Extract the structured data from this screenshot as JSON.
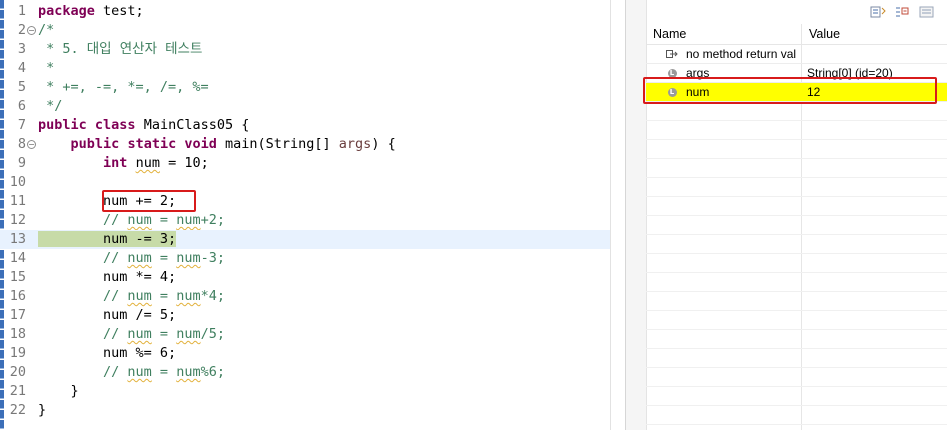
{
  "editor": {
    "lines": [
      {
        "n": "1",
        "fold": false,
        "current": false,
        "parts": [
          {
            "t": "package",
            "c": "kw"
          },
          {
            "t": " test;"
          }
        ]
      },
      {
        "n": "2",
        "fold": true,
        "current": false,
        "parts": [
          {
            "t": "/*",
            "c": "cmt"
          }
        ]
      },
      {
        "n": "3",
        "fold": false,
        "current": false,
        "parts": [
          {
            "t": " * 5. 대입 연산자 테스트",
            "c": "cmt"
          }
        ]
      },
      {
        "n": "4",
        "fold": false,
        "current": false,
        "parts": [
          {
            "t": " *",
            "c": "cmt"
          }
        ]
      },
      {
        "n": "5",
        "fold": false,
        "current": false,
        "parts": [
          {
            "t": " * +=, -=, *=, /=, %=",
            "c": "cmt"
          }
        ]
      },
      {
        "n": "6",
        "fold": false,
        "current": false,
        "parts": [
          {
            "t": " */",
            "c": "cmt"
          }
        ]
      },
      {
        "n": "7",
        "fold": false,
        "current": false,
        "parts": [
          {
            "t": "public",
            "c": "kw"
          },
          {
            "t": " "
          },
          {
            "t": "class",
            "c": "kw"
          },
          {
            "t": " MainClass05 {"
          }
        ]
      },
      {
        "n": "8",
        "fold": true,
        "current": false,
        "parts": [
          {
            "t": "    "
          },
          {
            "t": "public",
            "c": "kw"
          },
          {
            "t": " "
          },
          {
            "t": "static",
            "c": "kw"
          },
          {
            "t": " "
          },
          {
            "t": "void",
            "c": "kw"
          },
          {
            "t": " main(String[] "
          },
          {
            "t": "args",
            "c": "var"
          },
          {
            "t": ") {"
          }
        ]
      },
      {
        "n": "9",
        "fold": false,
        "current": false,
        "parts": [
          {
            "t": "        "
          },
          {
            "t": "int",
            "c": "kw"
          },
          {
            "t": " "
          },
          {
            "t": "num",
            "c": "sq"
          },
          {
            "t": " = 10;"
          }
        ]
      },
      {
        "n": "10",
        "fold": false,
        "current": false,
        "parts": []
      },
      {
        "n": "11",
        "fold": false,
        "current": false,
        "parts": [
          {
            "t": "        num += 2;"
          }
        ]
      },
      {
        "n": "12",
        "fold": false,
        "current": false,
        "parts": [
          {
            "t": "        // ",
            "c": "cmt"
          },
          {
            "t": "num",
            "c": "cmt sq"
          },
          {
            "t": " = ",
            "c": "cmt"
          },
          {
            "t": "num",
            "c": "cmt sq"
          },
          {
            "t": "+2;",
            "c": "cmt"
          }
        ]
      },
      {
        "n": "13",
        "fold": false,
        "current": true,
        "parts": [
          {
            "t": "        num -= 3;",
            "c": "sel"
          }
        ]
      },
      {
        "n": "14",
        "fold": false,
        "current": false,
        "parts": [
          {
            "t": "        // ",
            "c": "cmt"
          },
          {
            "t": "num",
            "c": "cmt sq"
          },
          {
            "t": " = ",
            "c": "cmt"
          },
          {
            "t": "num",
            "c": "cmt sq"
          },
          {
            "t": "-3;",
            "c": "cmt"
          }
        ]
      },
      {
        "n": "15",
        "fold": false,
        "current": false,
        "parts": [
          {
            "t": "        num *= 4;"
          }
        ]
      },
      {
        "n": "16",
        "fold": false,
        "current": false,
        "parts": [
          {
            "t": "        // ",
            "c": "cmt"
          },
          {
            "t": "num",
            "c": "cmt sq"
          },
          {
            "t": " = ",
            "c": "cmt"
          },
          {
            "t": "num",
            "c": "cmt sq"
          },
          {
            "t": "*4;",
            "c": "cmt"
          }
        ]
      },
      {
        "n": "17",
        "fold": false,
        "current": false,
        "parts": [
          {
            "t": "        num /= 5;"
          }
        ]
      },
      {
        "n": "18",
        "fold": false,
        "current": false,
        "parts": [
          {
            "t": "        // ",
            "c": "cmt"
          },
          {
            "t": "num",
            "c": "cmt sq"
          },
          {
            "t": " = ",
            "c": "cmt"
          },
          {
            "t": "num",
            "c": "cmt sq"
          },
          {
            "t": "/5;",
            "c": "cmt"
          }
        ]
      },
      {
        "n": "19",
        "fold": false,
        "current": false,
        "parts": [
          {
            "t": "        num %= 6;"
          }
        ]
      },
      {
        "n": "20",
        "fold": false,
        "current": false,
        "parts": [
          {
            "t": "        // ",
            "c": "cmt"
          },
          {
            "t": "num",
            "c": "cmt sq"
          },
          {
            "t": " = ",
            "c": "cmt"
          },
          {
            "t": "num",
            "c": "cmt sq"
          },
          {
            "t": "%6;",
            "c": "cmt"
          }
        ]
      },
      {
        "n": "21",
        "fold": false,
        "current": false,
        "parts": [
          {
            "t": "    }"
          }
        ]
      },
      {
        "n": "22",
        "fold": false,
        "current": false,
        "parts": [
          {
            "t": "}"
          }
        ]
      }
    ]
  },
  "variables": {
    "header": {
      "name": "Name",
      "value": "Value"
    },
    "rows": [
      {
        "icon": "method-return-icon",
        "name": "no method return val",
        "value": "",
        "highlighted": false
      },
      {
        "icon": "local-variable-icon",
        "name": "args",
        "value": "String[0]  (id=20)",
        "highlighted": false
      },
      {
        "icon": "local-variable-icon",
        "name": "num",
        "value": "12",
        "highlighted": true
      }
    ]
  },
  "colors": {
    "keyword": "#7f0055",
    "comment": "#3f7f5f",
    "current_line": "#e8f2fe",
    "debug_selection": "#c7dba8",
    "highlight_row": "#ffff00",
    "annotation_box": "#d81b1b"
  }
}
